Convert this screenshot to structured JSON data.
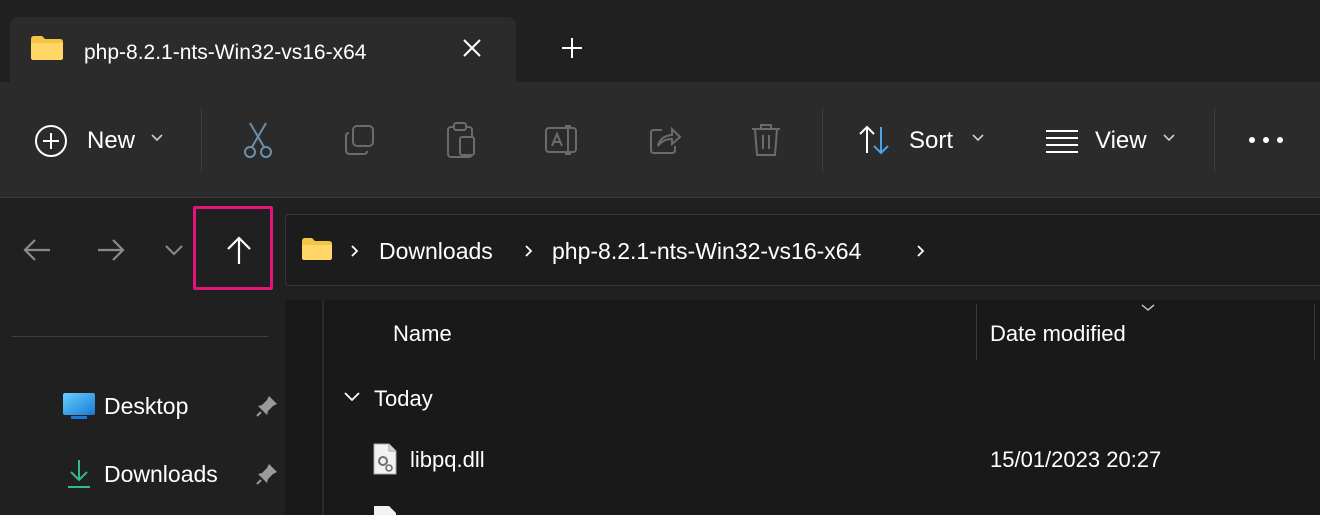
{
  "tab": {
    "title": "php-8.2.1-nts-Win32-vs16-x64",
    "icon": "folder-icon"
  },
  "toolbar": {
    "new_label": "New",
    "sort_label": "Sort",
    "view_label": "View",
    "icons": [
      "cut-icon",
      "copy-icon",
      "paste-icon",
      "rename-icon",
      "share-icon",
      "delete-icon",
      "more-icon"
    ]
  },
  "address": {
    "crumbs": [
      "Downloads",
      "php-8.2.1-nts-Win32-vs16-x64"
    ]
  },
  "navpane": {
    "items": [
      {
        "label": "Desktop",
        "icon": "desktop-icon",
        "pinned": true
      },
      {
        "label": "Downloads",
        "icon": "downloads-icon",
        "pinned": true
      }
    ]
  },
  "filelist": {
    "columns": [
      "Name",
      "Date modified"
    ],
    "group": "Today",
    "rows": [
      {
        "name": "libpq.dll",
        "date": "15/01/2023 20:27"
      }
    ]
  },
  "colors": {
    "highlight": "#e4157a",
    "folder": "#f4c542",
    "accent": "#4aa3e8"
  }
}
